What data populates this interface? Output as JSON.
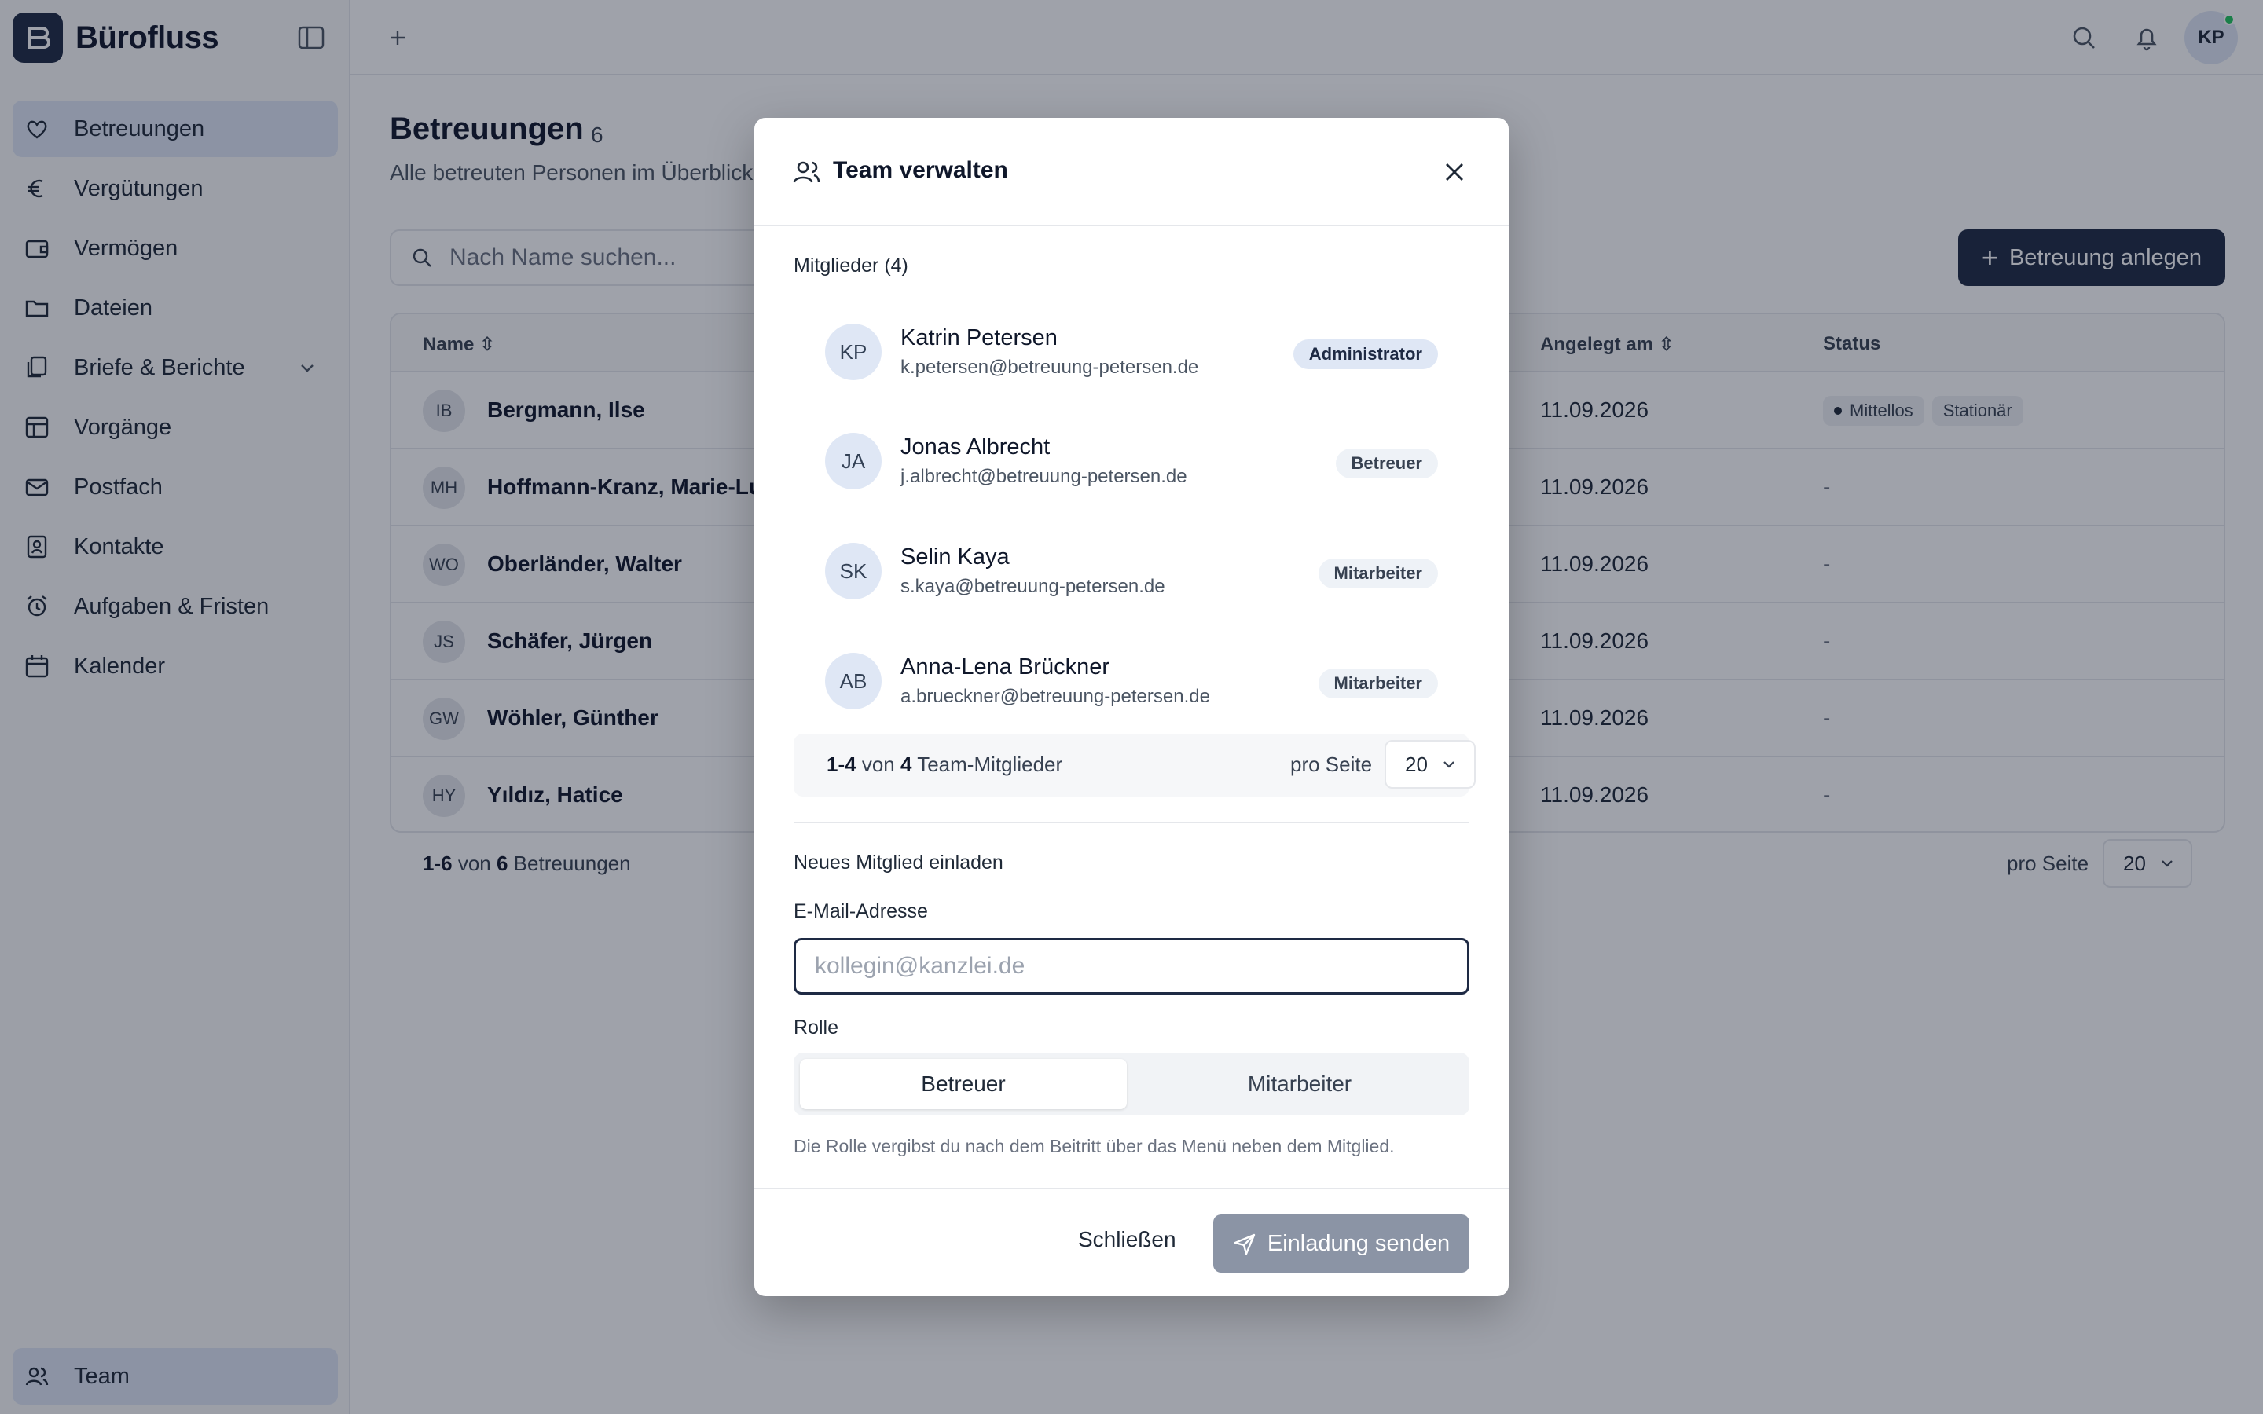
{
  "app": {
    "name": "Bürofluss",
    "user_initials": "KP"
  },
  "sidebar": {
    "items": [
      {
        "label": "Betreuungen",
        "icon": "heart-hand-icon",
        "active": true
      },
      {
        "label": "Vergütungen",
        "icon": "euro-icon"
      },
      {
        "label": "Vermögen",
        "icon": "wallet-icon"
      },
      {
        "label": "Dateien",
        "icon": "folder-icon"
      },
      {
        "label": "Briefe & Berichte",
        "icon": "documents-icon",
        "expandable": true
      },
      {
        "label": "Vorgänge",
        "icon": "table-icon"
      },
      {
        "label": "Postfach",
        "icon": "mail-icon"
      },
      {
        "label": "Kontakte",
        "icon": "contact-icon"
      },
      {
        "label": "Aufgaben & Fristen",
        "icon": "alarm-icon"
      },
      {
        "label": "Kalender",
        "icon": "calendar-icon"
      }
    ],
    "team_label": "Team"
  },
  "page": {
    "title": "Betreuungen",
    "count": "6",
    "subtitle": "Alle betreuten Personen im Überblick",
    "search_placeholder": "Nach Name suchen...",
    "primary_button": "Betreuung anlegen"
  },
  "table": {
    "headers": {
      "name": "Name",
      "created": "Angelegt am",
      "status": "Status"
    },
    "rows": [
      {
        "initials": "IB",
        "name": "Bergmann, Ilse",
        "date": "11.09.2026",
        "status": [
          "Mittellos",
          "Stationär"
        ]
      },
      {
        "initials": "MH",
        "name": "Hoffmann-Kranz, Marie-Luise",
        "date": "11.09.2026",
        "status_text": "-"
      },
      {
        "initials": "WO",
        "name": "Oberländer, Walter",
        "date": "11.09.2026",
        "status_text": "-"
      },
      {
        "initials": "JS",
        "name": "Schäfer, Jürgen",
        "date": "11.09.2026",
        "status_text": "-"
      },
      {
        "initials": "GW",
        "name": "Wöhler, Günther",
        "date": "11.09.2026",
        "status_text": "-"
      },
      {
        "initials": "HY",
        "name": "Yıldız, Hatice",
        "date": "11.09.2026",
        "status_text": "-"
      }
    ],
    "footer": {
      "range": "1-6",
      "von": "von",
      "total": "6",
      "unit": "Betreuungen",
      "per_page_label": "pro Seite",
      "per_page": "20"
    }
  },
  "modal": {
    "title": "Team verwalten",
    "members_label": "Mitglieder (4)",
    "members": [
      {
        "initials": "KP",
        "name": "Katrin Petersen",
        "email": "k.petersen@betreuung-petersen.de",
        "role": "Administrator"
      },
      {
        "initials": "JA",
        "name": "Jonas Albrecht",
        "email": "j.albrecht@betreuung-petersen.de",
        "role": "Betreuer"
      },
      {
        "initials": "SK",
        "name": "Selin Kaya",
        "email": "s.kaya@betreuung-petersen.de",
        "role": "Mitarbeiter"
      },
      {
        "initials": "AB",
        "name": "Anna-Lena Brückner",
        "email": "a.brueckner@betreuung-petersen.de",
        "role": "Mitarbeiter"
      }
    ],
    "pager": {
      "range": "1-4",
      "von": "von",
      "total": "4",
      "unit": "Team-Mitglieder",
      "per_page_label": "pro Seite",
      "per_page": "20"
    },
    "invite_label": "Neues Mitglied einladen",
    "email_label": "E-Mail-Adresse",
    "email_placeholder": "kollegin@kanzlei.de",
    "email_value": "",
    "role_label": "Rolle",
    "role_options": [
      "Betreuer",
      "Mitarbeiter"
    ],
    "role_selected": "Betreuer",
    "hint": "Die Rolle vergibst du nach dem Beitritt über das Menü neben dem Mitglied.",
    "close_button": "Schließen",
    "send_button": "Einladung senden"
  }
}
